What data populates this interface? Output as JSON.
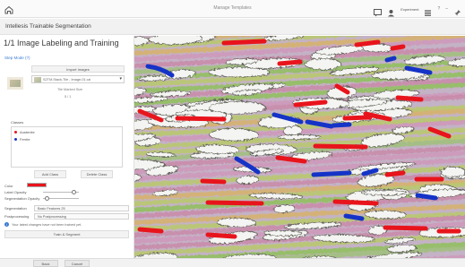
{
  "window": {
    "title": "Manage Templates"
  },
  "topbar": {
    "user_name": "Experiment",
    "help_label": "?"
  },
  "app": {
    "title": "Intellesis Trainable Segmentation"
  },
  "panel": {
    "step_title": "1/1 Image Labeling and Training",
    "step_link": "Step Mode (?)",
    "import_label": "Import Images",
    "image_name": "S2TM-Stack-Tile - Image-01.czi",
    "image_meta_1": "Tile Marked Size",
    "image_meta_2": "5 / 1",
    "classes_label": "Classes",
    "classes": [
      {
        "name": "Austenite",
        "color": "#e8141c"
      },
      {
        "name": "Ferrite",
        "color": "#1533c7"
      }
    ],
    "add_class": "Add Class",
    "delete_class": "Delete Class",
    "color_label": "Color",
    "color_value": "#e8141c",
    "label_opacity_label": "Label Opacity",
    "label_opacity": 0.85,
    "segmentation_opacity_label": "Segmentation Opacity",
    "segmentation_opacity": 0.1,
    "segmentation_label": "Segmentation",
    "segmentation_value": "Basic Features 25",
    "postprocessing_label": "Postprocessing",
    "postprocessing_value": "No Postprocessing",
    "notice": "Your latest changes have not been trained yet.",
    "train_button": "Train & Segment"
  },
  "bottom": {
    "back": "Back",
    "cancel": "Cancel"
  }
}
